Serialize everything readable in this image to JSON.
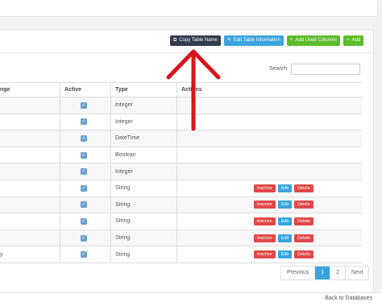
{
  "toolbar": {
    "copy_table_name": "Copy Table Name",
    "edit_table_information": "Edit Table Information",
    "add_used_columns": "Add Used Columns",
    "add": "Add"
  },
  "search": {
    "label": "Search:",
    "value": ""
  },
  "table": {
    "headers": {
      "name": "nge",
      "active": "Active",
      "type": "Type",
      "actions": "Actions"
    },
    "rows": [
      {
        "name": "",
        "active": true,
        "type": "Integer",
        "has_actions": false
      },
      {
        "name": "",
        "active": true,
        "type": "Integer",
        "has_actions": false
      },
      {
        "name": "",
        "active": true,
        "type": "DateTime",
        "has_actions": false
      },
      {
        "name": "",
        "active": true,
        "type": "Boolean",
        "has_actions": false
      },
      {
        "name": "",
        "active": true,
        "type": "Integer",
        "has_actions": false
      },
      {
        "name": "",
        "active": true,
        "type": "String",
        "has_actions": true
      },
      {
        "name": "",
        "active": true,
        "type": "String",
        "has_actions": true
      },
      {
        "name": "",
        "active": true,
        "type": "String",
        "has_actions": true
      },
      {
        "name": "",
        "active": true,
        "type": "String",
        "has_actions": true
      },
      {
        "name": "y",
        "active": true,
        "type": "String",
        "has_actions": true
      }
    ],
    "row_actions": {
      "inactive": "Inactive",
      "edit": "Edit",
      "delete": "Delete"
    }
  },
  "pagination": {
    "previous": "Previous",
    "pages": [
      "1",
      "2"
    ],
    "current": "1",
    "next": "Next"
  },
  "footer": {
    "back_link": "Back to Databases"
  },
  "colors": {
    "arrow": "#d8131b",
    "primary": "#3aa4dd",
    "danger": "#e04848",
    "success": "#5cbb2a",
    "dark": "#343b4c"
  }
}
